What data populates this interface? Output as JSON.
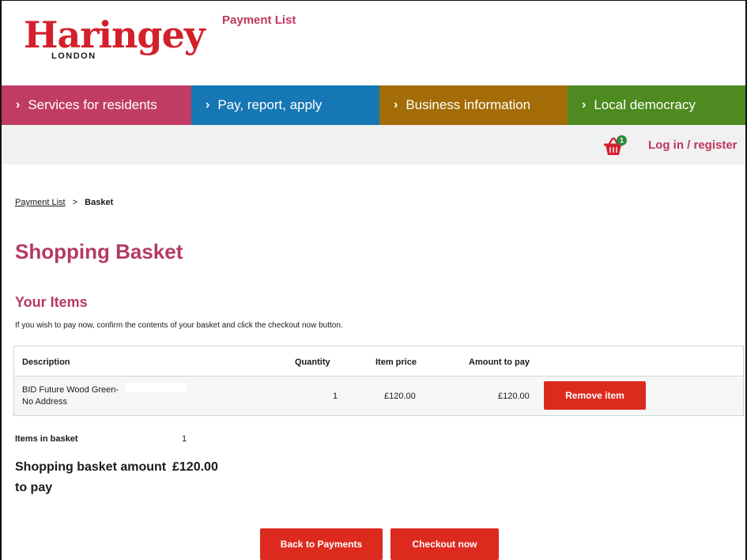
{
  "header": {
    "logo_text": "Haringey",
    "logo_sub": "LONDON"
  },
  "nav": {
    "items": [
      {
        "label": "Services for residents",
        "color": "#c13c63"
      },
      {
        "label": "Pay, report, apply",
        "color": "#1577b4"
      },
      {
        "label": "Business information",
        "color": "#a36c06"
      },
      {
        "label": "Local democracy",
        "color": "#4d8a20"
      }
    ],
    "chevron": "›"
  },
  "subbar": {
    "payment_list": "Payment List",
    "basket_count": "1",
    "login": "Log in / register"
  },
  "breadcrumb": {
    "link": "Payment List",
    "separator": ">",
    "current": "Basket"
  },
  "page_title": "Shopping Basket",
  "section_title": "Your Items",
  "intro": "If you wish to pay now, confirm the contents of your basket and click the checkout now button.",
  "table": {
    "headers": {
      "description": "Description",
      "quantity": "Quantity",
      "item_price": "Item price",
      "amount": "Amount to pay"
    },
    "rows": [
      {
        "description_line1": "BID Future Wood Green-",
        "description_line2": "No Address",
        "quantity": "1",
        "item_price": "£120.00",
        "amount": "£120.00",
        "remove_label": "Remove item"
      }
    ]
  },
  "summary": {
    "items_label": "Items in basket",
    "items_count": "1",
    "total_label": "Shopping basket amount to pay",
    "total_value": "£120.00"
  },
  "actions": {
    "back": "Back to Payments",
    "checkout": "Checkout now"
  },
  "colors": {
    "accent_pink": "#b53a5f",
    "button_red": "#dc2a1f",
    "logo_red": "#d4202c",
    "badge_green": "#2c8a3c"
  }
}
